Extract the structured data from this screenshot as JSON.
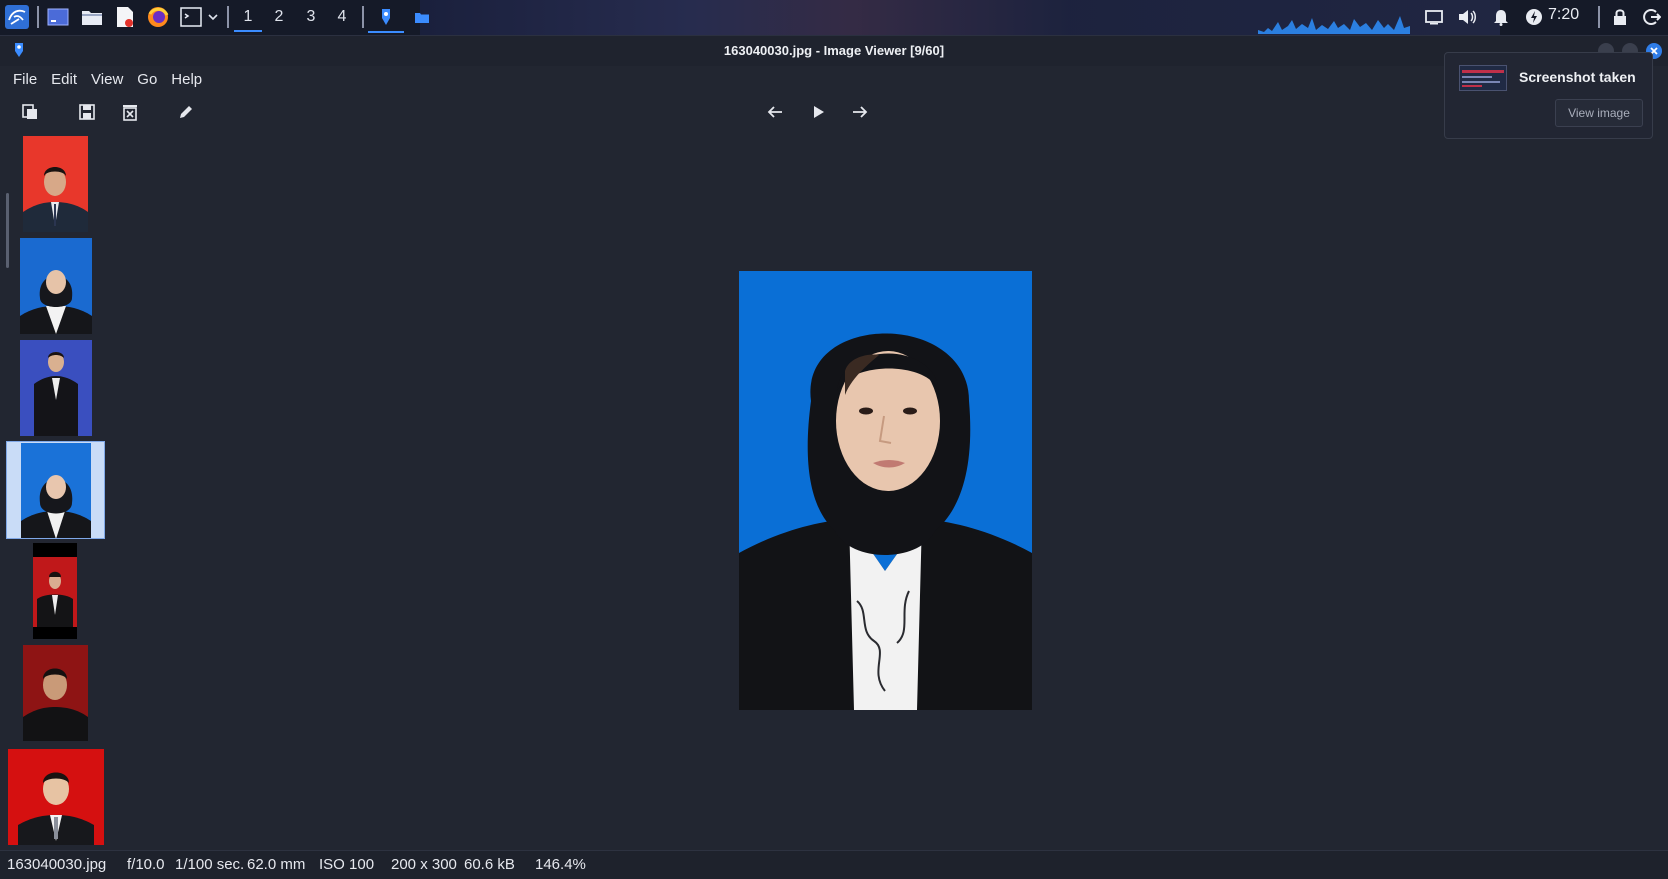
{
  "taskbar": {
    "workspaces": [
      "1",
      "2",
      "3",
      "4"
    ],
    "active_workspace": "1",
    "clock": "7:20"
  },
  "window": {
    "title": "163040030.jpg - Image Viewer [9/60]"
  },
  "menu": [
    "File",
    "Edit",
    "View",
    "Go",
    "Help"
  ],
  "toolbar": {
    "left_icons": [
      "copy-icon",
      "save-as-icon",
      "delete-icon",
      "edit-icon"
    ],
    "nav_icons": [
      "previous-arrow-icon",
      "play-slideshow-icon",
      "next-arrow-icon"
    ]
  },
  "thumbnails": [
    {
      "bg": "#e8372b",
      "selected": false
    },
    {
      "bg": "#1a6ad0",
      "selected": false
    },
    {
      "bg": "#3a4fbf",
      "selected": false
    },
    {
      "bg": "#1a72d8",
      "selected": true
    },
    {
      "bg": "#c0181a",
      "selected": false
    },
    {
      "bg": "#8e1414",
      "selected": false
    },
    {
      "bg": "#d51010",
      "selected": false
    }
  ],
  "notification": {
    "title": "Screenshot taken",
    "button": "View image"
  },
  "statusbar": {
    "filename": "163040030.jpg",
    "aperture": "f/10.0",
    "shutter": "1/100 sec.",
    "focal": "62.0 mm",
    "iso": "ISO 100",
    "dimensions": "200 x 300",
    "filesize": "60.6 kB",
    "zoom": "146.4%"
  },
  "colors": {
    "accent": "#3b8cff",
    "photo_bg": "#0a6fd6"
  }
}
